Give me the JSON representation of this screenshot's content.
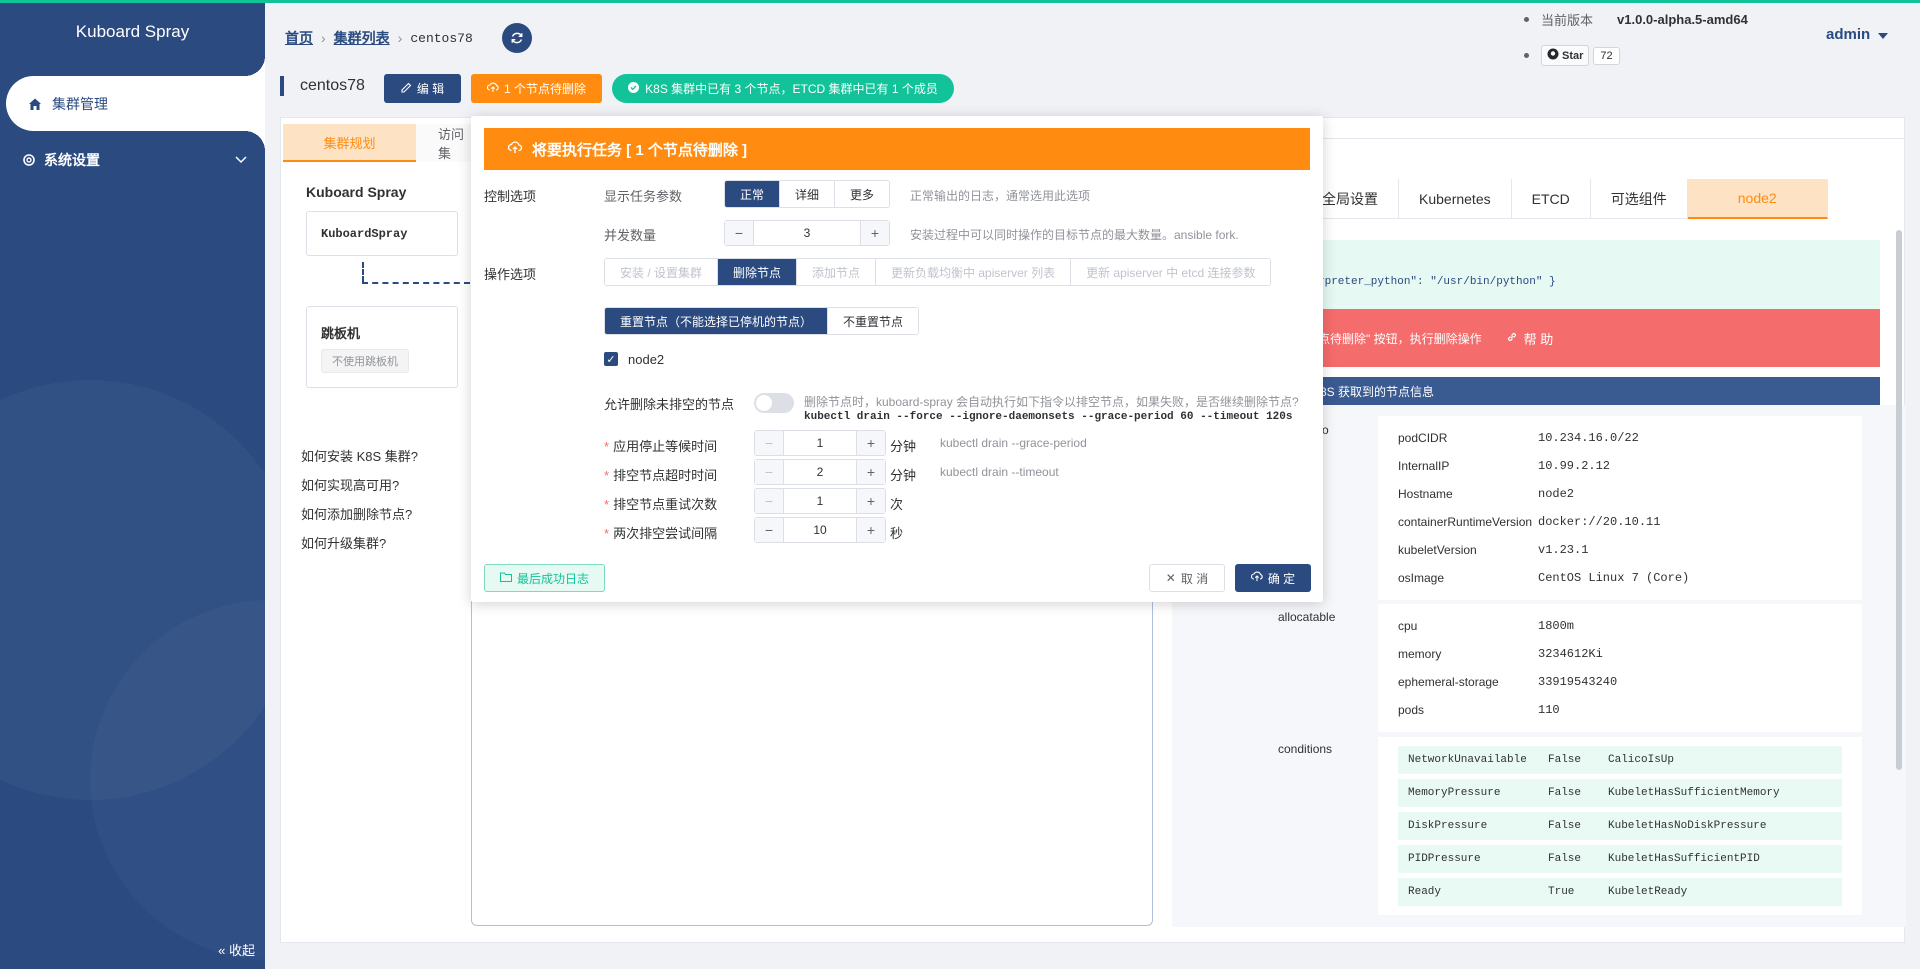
{
  "app": {
    "title": "Kuboard Spray"
  },
  "sidebar": {
    "items": [
      {
        "label": "集群管理",
        "icon": "home-icon"
      },
      {
        "label": "系统设置",
        "icon": "gear-icon"
      }
    ],
    "collapse_label": "收起"
  },
  "breadcrumb": {
    "home": "首页",
    "list": "集群列表",
    "current": "centos78"
  },
  "header": {
    "version_label": "当前版本",
    "version": "v1.0.0-alpha.5-amd64",
    "star_label": "Star",
    "star_count": "72",
    "user": "admin"
  },
  "cluster": {
    "name": "centos78",
    "edit_label": "编 辑",
    "pending_label": "1 个节点待删除",
    "status_label": "K8S 集群中已有 3 个节点，ETCD 集群中已有 1 个成员"
  },
  "tabs": {
    "plan": "集群规划",
    "access": "访问集"
  },
  "plan": {
    "title": "Kuboard Spray",
    "box": "KuboardSpray",
    "jump_title": "跳板机",
    "jump_tag": "不使用跳板机",
    "help": [
      "如何安装 K8S 集群?",
      "如何实现高可用?",
      "如何添加删除节点?",
      "如何升级集群?"
    ]
  },
  "right": {
    "tabs": [
      "全局设置",
      "Kubernetes",
      "ETCD",
      "可选组件",
      "node2"
    ],
    "code": "rpreter_python\": \"/usr/bin/python\" }",
    "red_text": "点待删除\" 按钮，执行删除操作",
    "help_label": "帮 助",
    "k8s_head": "8S 获取到的节点信息",
    "o_label": "o",
    "node_info": [
      {
        "k": "podCIDR",
        "v": "10.234.16.0/22"
      },
      {
        "k": "InternalIP",
        "v": "10.99.2.12"
      },
      {
        "k": "Hostname",
        "v": "node2"
      },
      {
        "k": "containerRuntimeVersion",
        "v": "docker://20.10.11"
      },
      {
        "k": "kubeletVersion",
        "v": "v1.23.1"
      },
      {
        "k": "osImage",
        "v": "CentOS Linux 7 (Core)"
      }
    ],
    "allocatable_label": "allocatable",
    "allocatable": [
      {
        "k": "cpu",
        "v": "1800m"
      },
      {
        "k": "memory",
        "v": "3234612Ki"
      },
      {
        "k": "ephemeral-storage",
        "v": "33919543240"
      },
      {
        "k": "pods",
        "v": "110"
      }
    ],
    "conditions_label": "conditions",
    "conditions": [
      {
        "type": "NetworkUnavailable",
        "status": "False",
        "reason": "CalicoIsUp"
      },
      {
        "type": "MemoryPressure",
        "status": "False",
        "reason": "KubeletHasSufficientMemory"
      },
      {
        "type": "DiskPressure",
        "status": "False",
        "reason": "KubeletHasNoDiskPressure"
      },
      {
        "type": "PIDPressure",
        "status": "False",
        "reason": "KubeletHasSufficientPID"
      },
      {
        "type": "Ready",
        "status": "True",
        "reason": "KubeletReady"
      }
    ]
  },
  "modal": {
    "title": "将要执行任务 [ 1 个节点待删除 ]",
    "control_label": "控制选项",
    "show_params_label": "显示任务参数",
    "verbosity_options": [
      "正常",
      "详细",
      "更多"
    ],
    "verbosity_hint": "正常输出的日志，通常选用此选项",
    "concurrency_label": "并发数量",
    "concurrency_value": "3",
    "concurrency_hint": "安装过程中可以同时操作的目标节点的最大数量。ansible fork.",
    "action_label": "操作选项",
    "actions": [
      "安装 / 设置集群",
      "删除节点",
      "添加节点",
      "更新负载均衡中 apiserver 列表",
      "更新 apiserver 中 etcd 连接参数"
    ],
    "reset_options": [
      "重置节点（不能选择已停机的节点）",
      "不重置节点"
    ],
    "node_checkbox": "node2",
    "allow_drain_label": "允许删除未排空的节点",
    "allow_drain_hint": "删除节点时，kuboard-spray 会自动执行如下指令以排空节点，如果失败，是否继续删除节点?",
    "drain_cmd": "kubectl drain --force --ignore-daemonsets --grace-period 60 --timeout 120s",
    "fields": [
      {
        "label": "应用停止等候时间",
        "value": "1",
        "unit": "分钟",
        "hint": "kubectl drain --grace-period"
      },
      {
        "label": "排空节点超时时间",
        "value": "2",
        "unit": "分钟",
        "hint": "kubectl drain --timeout"
      },
      {
        "label": "排空节点重试次数",
        "value": "1",
        "unit": "次",
        "hint": ""
      },
      {
        "label": "两次排空尝试间隔",
        "value": "10",
        "unit": "秒",
        "hint": ""
      }
    ],
    "log_btn": "最后成功日志",
    "cancel_btn": "取 消",
    "ok_btn": "确 定"
  }
}
